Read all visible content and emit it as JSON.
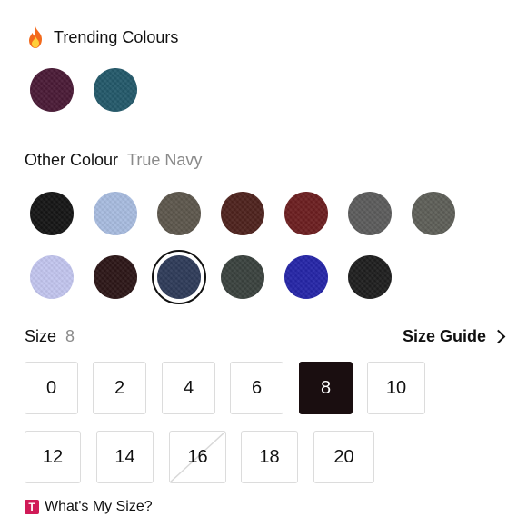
{
  "trending": {
    "title": "Trending Colours",
    "swatches": [
      {
        "name": "plum",
        "color": "#4a1a36"
      },
      {
        "name": "teal",
        "color": "#23596a"
      }
    ]
  },
  "other": {
    "title": "Other Colour",
    "selected_name": "True Navy",
    "swatches": [
      {
        "color": "#151515"
      },
      {
        "color": "#a8bce0"
      },
      {
        "color": "#5d574c"
      },
      {
        "color": "#4e221d"
      },
      {
        "color": "#6c1e20"
      },
      {
        "color": "#5c5c5c"
      },
      {
        "color": "#5e5f58"
      },
      {
        "color": "#c3c6ef"
      },
      {
        "color": "#2c1617"
      },
      {
        "color": "#2e3b59",
        "selected": true
      },
      {
        "color": "#3a423e"
      },
      {
        "color": "#2525a8"
      },
      {
        "color": "#1e1e1e"
      }
    ]
  },
  "size": {
    "label": "Size",
    "selected_value": "8",
    "guide_label": "Size Guide",
    "options": [
      {
        "value": "0"
      },
      {
        "value": "2"
      },
      {
        "value": "4"
      },
      {
        "value": "6"
      },
      {
        "value": "8",
        "selected": true
      },
      {
        "value": "10"
      },
      {
        "value": "12"
      },
      {
        "value": "14"
      },
      {
        "value": "16",
        "unavailable": true
      },
      {
        "value": "18"
      },
      {
        "value": "20"
      }
    ]
  },
  "help": {
    "badge": "T",
    "link_text": "What's My Size?"
  },
  "icons": {
    "trending": "fire-icon",
    "size_guide": "chevron-right-icon"
  }
}
